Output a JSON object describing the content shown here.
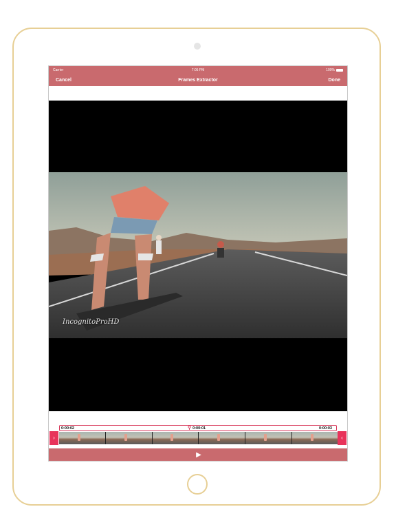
{
  "status_bar": {
    "carrier": "Carrier",
    "time": "7:05 PM",
    "battery": "100%"
  },
  "nav": {
    "cancel_label": "Cancel",
    "title": "Frames Extractor",
    "done_label": "Done"
  },
  "video": {
    "watermark": "IncognitoProHD"
  },
  "timeline": {
    "start_time": "0:00:02",
    "selected_time": "0:00:01",
    "end_time": "0:00:03",
    "left_handle": "›",
    "right_handle": "‹",
    "thumbnail_count": 6
  },
  "controls": {
    "play_icon": "play-icon",
    "play_glyph": "▶"
  },
  "colors": {
    "nav_background": "#c96a6e",
    "accent": "#e8335a",
    "device_frame": "#e7cf95"
  }
}
